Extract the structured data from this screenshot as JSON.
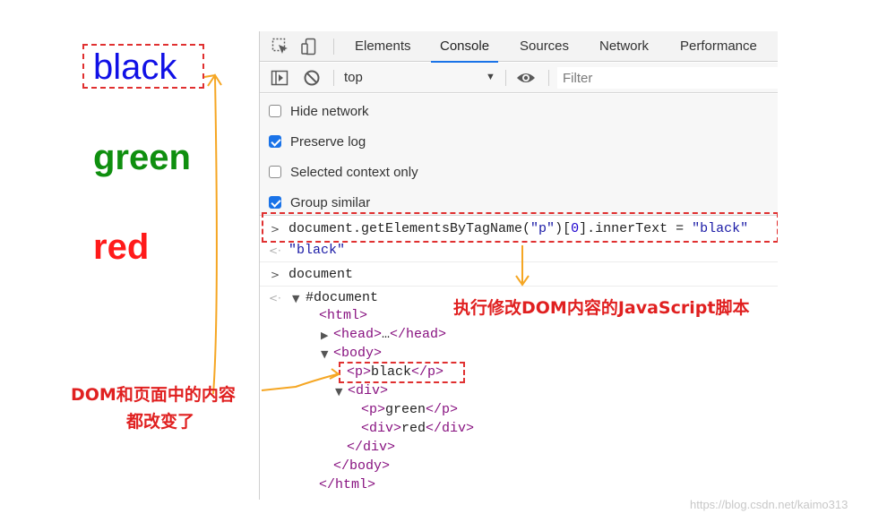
{
  "page": {
    "words": [
      "black",
      "green",
      "red"
    ],
    "colors": {
      "black_word": "#1010e6",
      "green_word": "#0f8f0f",
      "red_word": "#ff1a1a"
    }
  },
  "devtools": {
    "tabs": [
      "Elements",
      "Console",
      "Sources",
      "Network",
      "Performance"
    ],
    "active_tab": "Console",
    "toolbar": {
      "context": "top",
      "filter_placeholder": "Filter"
    },
    "settings": [
      {
        "label": "Hide network",
        "checked": false
      },
      {
        "label": "Preserve log",
        "checked": true
      },
      {
        "label": "Selected context only",
        "checked": false
      },
      {
        "label": "Group similar",
        "checked": true
      }
    ],
    "console": {
      "command_prefix": "document.getElementsByTagName(",
      "command_arg": "\"p\"",
      "command_mid": ")[",
      "command_index": "0",
      "command_suffix": "].innerText = ",
      "command_value": "\"black\"",
      "result": "\"black\"",
      "command2": "document",
      "result2": "#document"
    },
    "dom_tree": {
      "html_open": "<html>",
      "head_open": "<head>",
      "head_ellipsis": "…",
      "head_close": "</head>",
      "body_open": "<body>",
      "p_open": "<p>",
      "p1_text": "black",
      "p_close": "</p>",
      "div_open": "<div>",
      "p2_text": "green",
      "div2_text": "red",
      "div_close": "</div>",
      "body_close": "</body>",
      "html_close": "</html>"
    },
    "accent": "#1a73e8"
  },
  "annotations": {
    "script_note": "执行修改DOM内容的JavaScript脚本",
    "dom_note_line1": "DOM和页面中的内容",
    "dom_note_line2": "都改变了",
    "highlight_color": "#e03030",
    "arrow_color": "#f5a623"
  },
  "watermark": "https://blog.csdn.net/kaimo313"
}
